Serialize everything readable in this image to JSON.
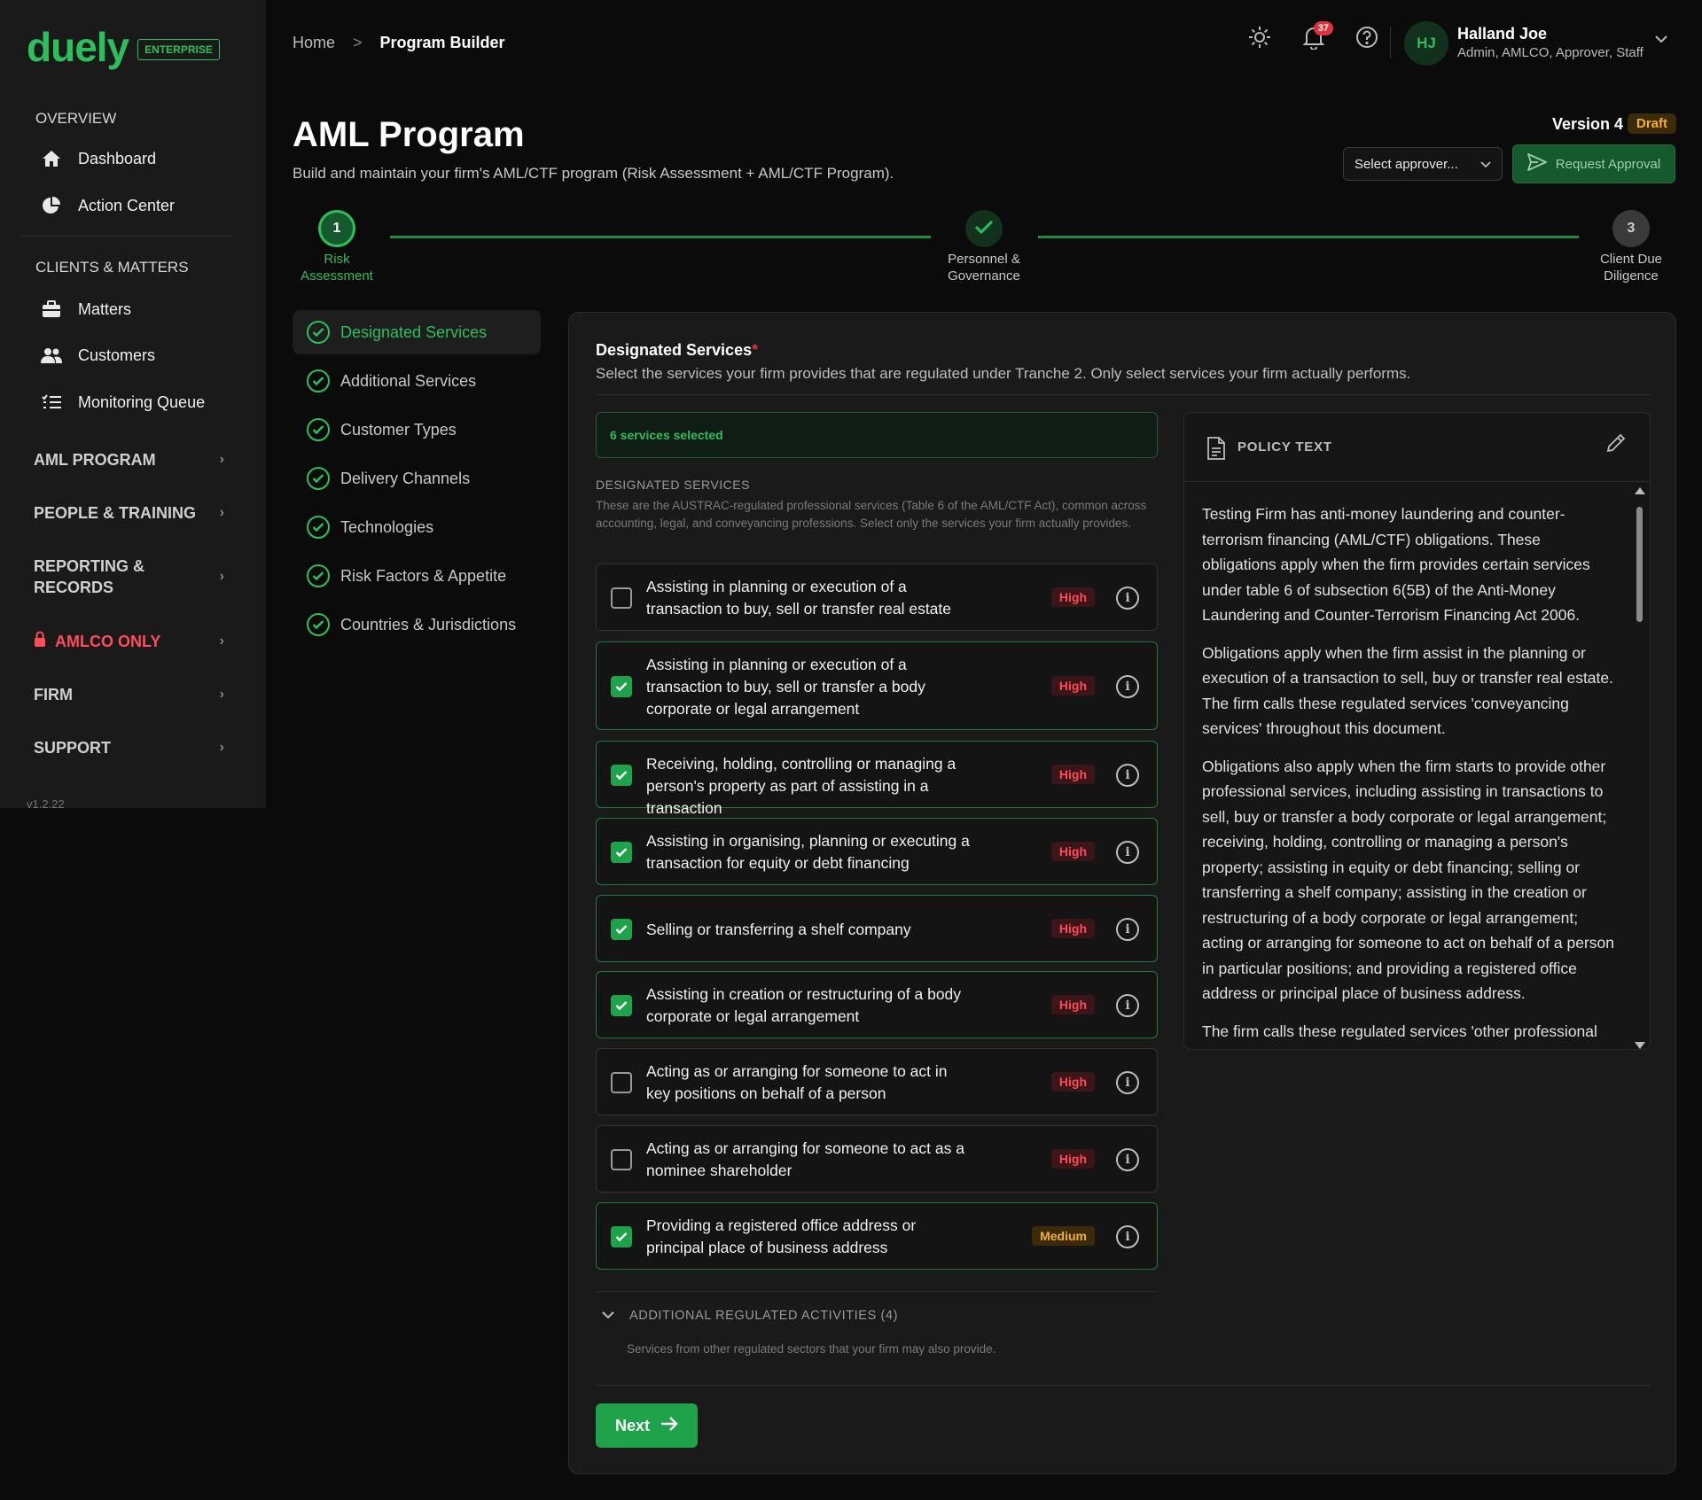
{
  "brand": {
    "name": "duely",
    "badge": "ENTERPRISE",
    "color": "#2dbf5c"
  },
  "sidebar": {
    "overview_heading": "OVERVIEW",
    "overview_items": [
      {
        "label": "Dashboard",
        "icon": "home-icon"
      },
      {
        "label": "Action Center",
        "icon": "pie-chart-icon"
      }
    ],
    "clients_heading": "CLIENTS & MATTERS",
    "clients_items": [
      {
        "label": "Matters",
        "icon": "briefcase-icon"
      },
      {
        "label": "Customers",
        "icon": "users-icon"
      },
      {
        "label": "Monitoring Queue",
        "icon": "list-icon"
      }
    ],
    "groups": [
      {
        "label": "AML PROGRAM"
      },
      {
        "label": "PEOPLE & TRAINING"
      },
      {
        "label": "REPORTING & RECORDS"
      },
      {
        "label": "AMLCO ONLY",
        "icon": "lock-icon"
      },
      {
        "label": "FIRM"
      },
      {
        "label": "SUPPORT"
      }
    ],
    "version": "v1.2.22"
  },
  "header": {
    "breadcrumb": {
      "home": "Home",
      "separator": ">",
      "current": "Program Builder"
    },
    "notifications_count": "37",
    "user": {
      "initials": "HJ",
      "name": "Halland Joe",
      "role": "Admin, AMLCO, Approver, Staff"
    }
  },
  "page": {
    "title": "AML Program",
    "subtitle": "Build and maintain your firm's AML/CTF program (Risk Assessment + AML/CTF Program).",
    "version_label": "Version 4",
    "status_badge": "Draft",
    "approver_placeholder": "Select approver...",
    "request_approval": "Request Approval"
  },
  "stepper": {
    "steps": [
      {
        "number": "1",
        "label_line1": "Risk",
        "label_line2": "Assessment",
        "state": "current"
      },
      {
        "number": "✓",
        "label_line1": "Personnel &",
        "label_line2": "Governance",
        "state": "done"
      },
      {
        "number": "3",
        "label_line1": "Client Due",
        "label_line2": "Diligence",
        "state": "upcoming"
      }
    ]
  },
  "subnav": {
    "items": [
      {
        "label": "Designated Services"
      },
      {
        "label": "Additional Services"
      },
      {
        "label": "Customer Types"
      },
      {
        "label": "Delivery Channels"
      },
      {
        "label": "Technologies"
      },
      {
        "label": "Risk Factors & Appetite"
      },
      {
        "label": "Countries & Jurisdictions"
      }
    ]
  },
  "section": {
    "title": "Designated Services",
    "required_mark": "*",
    "description": "Select the services your firm provides that are regulated under Tranche 2. Only select services your firm actually performs.",
    "selected_summary": "6 services selected",
    "list_heading": "DESIGNATED SERVICES",
    "list_help": "These are the AUSTRAC-regulated professional services (Table 6 of the AML/CTF Act), common across accounting, legal, and conveyancing professions. Select only the services your firm actually provides.",
    "services": [
      {
        "label": "Assisting in planning or execution of a transaction to buy, sell or transfer real estate",
        "risk": "High",
        "checked": false
      },
      {
        "label": "Assisting in planning or execution of a transaction to buy, sell or transfer a body corporate or legal arrangement",
        "risk": "High",
        "checked": true
      },
      {
        "label": "Receiving, holding, controlling or managing a person's property as part of assisting in a transaction",
        "risk": "High",
        "checked": true
      },
      {
        "label": "Assisting in organising, planning or executing a transaction for equity or debt financing",
        "risk": "High",
        "checked": true
      },
      {
        "label": "Selling or transferring a shelf company",
        "risk": "High",
        "checked": true
      },
      {
        "label": "Assisting in creation or restructuring of a body corporate or legal arrangement",
        "risk": "High",
        "checked": true
      },
      {
        "label": "Acting as or arranging for someone to act in key positions on behalf of a person",
        "risk": "High",
        "checked": false
      },
      {
        "label": "Acting as or arranging for someone to act as a nominee shareholder",
        "risk": "High",
        "checked": false
      },
      {
        "label": "Providing a registered office address or principal place of business address",
        "risk": "Medium",
        "checked": true
      }
    ],
    "additional_heading": "ADDITIONAL REGULATED ACTIVITIES (4)",
    "additional_desc": "Services from other regulated sectors that your firm may also provide.",
    "next_label": "Next"
  },
  "policy": {
    "title": "POLICY TEXT",
    "paragraphs": [
      "Testing Firm has anti-money laundering and counter-terrorism financing (AML/CTF) obligations. These obligations apply when the firm provides certain services under table 6 of subsection 6(5B) of the Anti-Money Laundering and Counter-Terrorism Financing Act 2006.",
      "Obligations apply when the firm assist in the planning or execution of a transaction to sell, buy or transfer real estate. The firm calls these regulated services 'conveyancing services' throughout this document.",
      "Obligations also apply when the firm starts to provide other professional services, including assisting in transactions to sell, buy or transfer a body corporate or legal arrangement; receiving, holding, controlling or managing a person's property; assisting in equity or debt financing; selling or transferring a shelf company; assisting in the creation or restructuring of a body corporate or legal arrangement; acting or arranging for someone to act on behalf of a person in particular positions; and providing a registered office address or principal place of business address.",
      "The firm calls these regulated services 'other professional"
    ]
  }
}
